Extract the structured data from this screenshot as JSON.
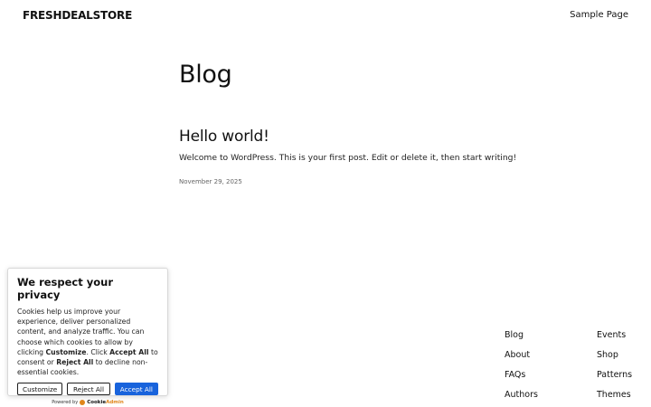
{
  "header": {
    "site_title": "FRESHDEALSTORE",
    "nav": [
      "Sample Page"
    ]
  },
  "main": {
    "heading": "Blog",
    "posts": [
      {
        "title": "Hello world!",
        "excerpt": "Welcome to WordPress. This is your first post. Edit or delete it, then start writing!",
        "date": "November 29, 2025"
      }
    ]
  },
  "footer": {
    "column1": [
      "Blog",
      "About",
      "FAQs",
      "Authors"
    ],
    "column2": [
      "Events",
      "Shop",
      "Patterns",
      "Themes"
    ]
  },
  "cookie_banner": {
    "title": "We respect your privacy",
    "text_1": "Cookies help us improve your experience, deliver personalized content, and analyze traffic. You can choose which cookies to allow by clicking ",
    "bold_1": "Customize",
    "text_2": ". Click ",
    "bold_2": "Accept All",
    "text_3": " to consent or ",
    "bold_3": "Reject All",
    "text_4": " to decline non-essential cookies.",
    "customize_label": "Customize",
    "reject_label": "Reject All",
    "accept_label": "Accept All",
    "powered_by": "Powered by",
    "brand_part1": "Cookie",
    "brand_part2": "Admin",
    "accent_color": "#1863dc"
  }
}
